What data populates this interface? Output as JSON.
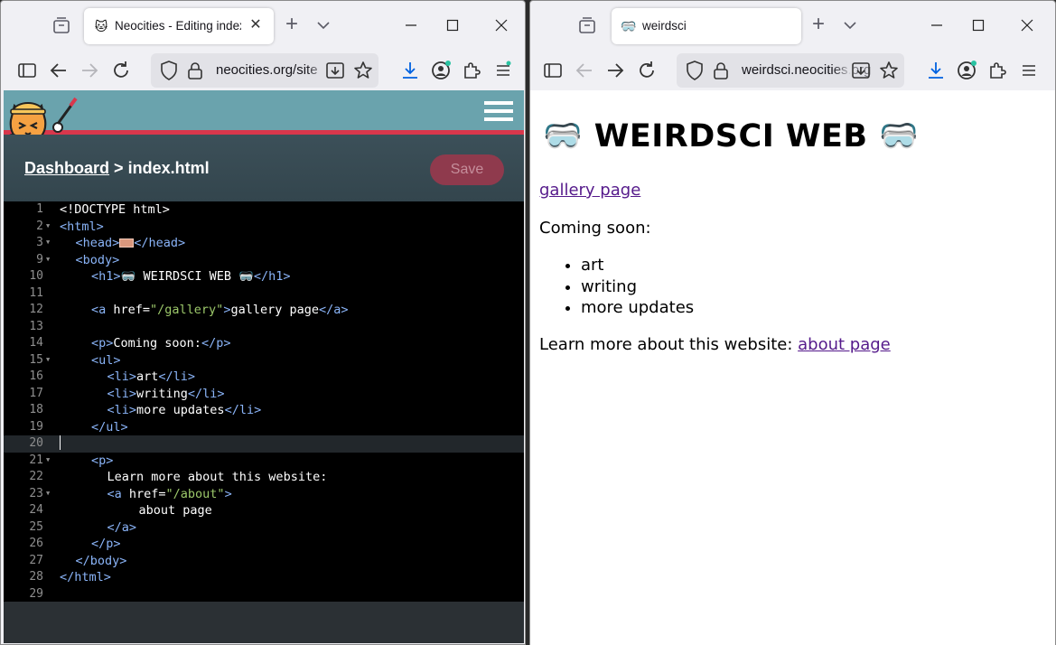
{
  "left_window": {
    "tab": {
      "title": "Neocities - Editing index.h"
    },
    "url": {
      "host": "neocities.org/site"
    },
    "neocities": {
      "breadcrumb": {
        "dashboard": "Dashboard",
        "separator": ">",
        "file": "index.html"
      },
      "save_label": "Save"
    },
    "editor": {
      "active_line": 20,
      "lines": [
        {
          "num": "1",
          "code": "<!DOCTYPE html>"
        },
        {
          "num": "2",
          "code": "<html>"
        },
        {
          "num": "3",
          "code": "<head>…</head>"
        },
        {
          "num": "9",
          "code": "<body>"
        },
        {
          "num": "10",
          "code": "<h1>🥽 WEIRDSCI WEB 🥽</h1>"
        },
        {
          "num": "11",
          "code": ""
        },
        {
          "num": "12",
          "code": "<a href=\"/gallery\">gallery page</a>"
        },
        {
          "num": "13",
          "code": ""
        },
        {
          "num": "14",
          "code": "<p>Coming soon:</p>"
        },
        {
          "num": "15",
          "code": "<ul>"
        },
        {
          "num": "16",
          "code": "<li>art</li>"
        },
        {
          "num": "17",
          "code": "<li>writing</li>"
        },
        {
          "num": "18",
          "code": "<li>more updates</li>"
        },
        {
          "num": "19",
          "code": "</ul>"
        },
        {
          "num": "20",
          "code": ""
        },
        {
          "num": "21",
          "code": "<p>"
        },
        {
          "num": "22",
          "code": "Learn more about this website:"
        },
        {
          "num": "23",
          "code": "<a href=\"/about\">"
        },
        {
          "num": "24",
          "code": "about page"
        },
        {
          "num": "25",
          "code": "</a>"
        },
        {
          "num": "26",
          "code": "</p>"
        },
        {
          "num": "27",
          "code": "</body>"
        },
        {
          "num": "28",
          "code": "</html>"
        },
        {
          "num": "29",
          "code": ""
        }
      ]
    }
  },
  "right_window": {
    "tab": {
      "title": "weirdsci"
    },
    "url": {
      "host_main": "weirdsci.neocities",
      "host_rest": ".org"
    },
    "page": {
      "heading": "🥽 WEIRDSCI WEB 🥽",
      "gallery_link": "gallery page",
      "coming_soon": "Coming soon:",
      "list": [
        "art",
        "writing",
        "more updates"
      ],
      "learn_more": "Learn more about this website: ",
      "about_link": "about page"
    }
  },
  "colors": {
    "neocities_header": "#6aa3ad",
    "neocities_accent": "#d9374c",
    "save_button": "#8f3a4d",
    "visited_link": "#551a8b",
    "editor_tag": "#8ab4f8",
    "editor_string": "#9cc86a"
  },
  "icons": [
    "tab-list-icon",
    "cat-favicon-icon",
    "goggles-favicon-icon",
    "close-tab-icon",
    "new-tab-icon",
    "tab-overflow-chevron-icon",
    "minimize-icon",
    "maximize-icon",
    "close-window-icon",
    "sidebar-icon",
    "back-icon",
    "forward-icon",
    "reload-icon",
    "shield-icon",
    "lock-icon",
    "save-to-pocket-icon",
    "bookmark-star-icon",
    "downloads-icon",
    "account-icon",
    "extensions-icon",
    "menu-icon",
    "neocities-cat-logo-icon",
    "hamburger-menu-icon"
  ]
}
